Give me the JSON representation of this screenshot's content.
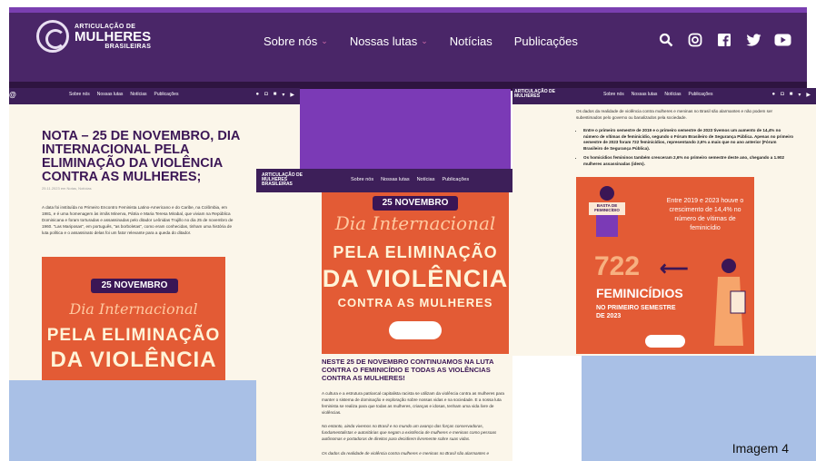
{
  "site": {
    "logo": {
      "line1": "ARTICULAÇÃO DE",
      "line2": "MULHERES",
      "line3": "BRASILEIRAS"
    },
    "nav": [
      "Sobre nós",
      "Nossas lutas",
      "Notícias",
      "Publicações"
    ],
    "social_icons": [
      "search-icon",
      "instagram-icon",
      "facebook-icon",
      "twitter-icon",
      "youtube-icon"
    ]
  },
  "left": {
    "title": "NOTA – 25 DE NOVEMBRO, DIA INTERNACIONAL PELA ELIMINAÇÃO DA VIOLÊNCIA CONTRA AS MULHERES;",
    "date": "25.11.2023 em Notas, Notícias",
    "paragraph": "A data foi instituída no Primeiro Encontro Feminista Latino-Americano e do Caribe, na Colômbia, em 1981, e é uma homenagem às irmãs Minerva, Pátria e Maria Teresa Mirabal, que viviam na República Dominicana e foram torturadas e assassinadas pelo ditador Leônidas Trujillo no dia 25 de novembro de 1960. \"Las Mariposas\", em português, \"as borboletas\", como eram conhecidas, tinham uma história de luta política e o assassinato delas foi um fator relevante para a queda do ditador.",
    "poster": {
      "badge": "25 NOVEMBRO",
      "script": "Dia Internacional",
      "line1": "PELA ELIMINAÇÃO",
      "line2": "DA VIOLÊNCIA"
    }
  },
  "middle": {
    "poster": {
      "badge": "25 NOVEMBRO",
      "script": "Dia Internacional",
      "line1": "PELA ELIMINAÇÃO",
      "line2": "DA VIOLÊNCIA",
      "line3": "CONTRA AS MULHERES"
    },
    "heading": "NESTE 25 DE NOVEMBRO CONTINUAMOS NA LUTA CONTRA O FEMINICÍDIO E TODAS AS VIOLÊNCIAS CONTRA AS MULHERES!",
    "p1": "A cultura e a estrutura patriarcal capitalista racista se utilizam da violência contra as mulheres para manter o sistema de dominação e exploração sobre nossas vidas e na sociedade. E a nossa luta feminista se realiza para que todas as mulheres, crianças e idosas, tenham uma vida livre de violências.",
    "p2": "No entanto, ainda vivemos no Brasil e no mundo um avanço das forças conservadoras, fundamentalistas e autoritárias que negam a existência de mulheres e meninas como pessoas autônomas e portadoras de direitos para decidirem livremente sobre suas vidas.",
    "p3": "Os dados da realidade de violência contra mulheres e meninas no Brasil são alarmantes e"
  },
  "right": {
    "intro": "Os dados da realidade de violência contra mulheres e meninas no Brasil são alarmantes e não podem ser subestimados pelo governo ou banalizados pela sociedade.",
    "bullets": [
      "Entre o primeiro semestre de 2019 e o primeiro semestre de 2023 tivemos um aumento de 14,4% no número de vítimas de feminicídio, segundo o Fórum Brasileiro de Segurança Pública. Apenas no primeiro semestre de 2023 foram 722 feminicídios, representando 2,6% a mais que no ano anterior (Fórum Brasileiro de Segurança Pública).",
      "Os homicídios femininos também cresceram 2,6% no primeiro semestre deste ano, chegando a 1.902 mulheres assassinadas (idem)."
    ],
    "stat": {
      "text": "Entre 2019 e 2023 houve o crescimento de 14,4% no número de vítimas de feminicídio",
      "number": "722",
      "big": "FEMINICÍDIOS",
      "sub": "NO PRIMEIRO SEMESTRE DE 2023",
      "sign": "BASTA DE FEMINICÍDIO"
    }
  },
  "caption": "Imagem 4",
  "colors": {
    "header": "#4a2668",
    "poster": "#e35b35",
    "heading": "#3b1655",
    "blue": "#a9c0e6"
  }
}
